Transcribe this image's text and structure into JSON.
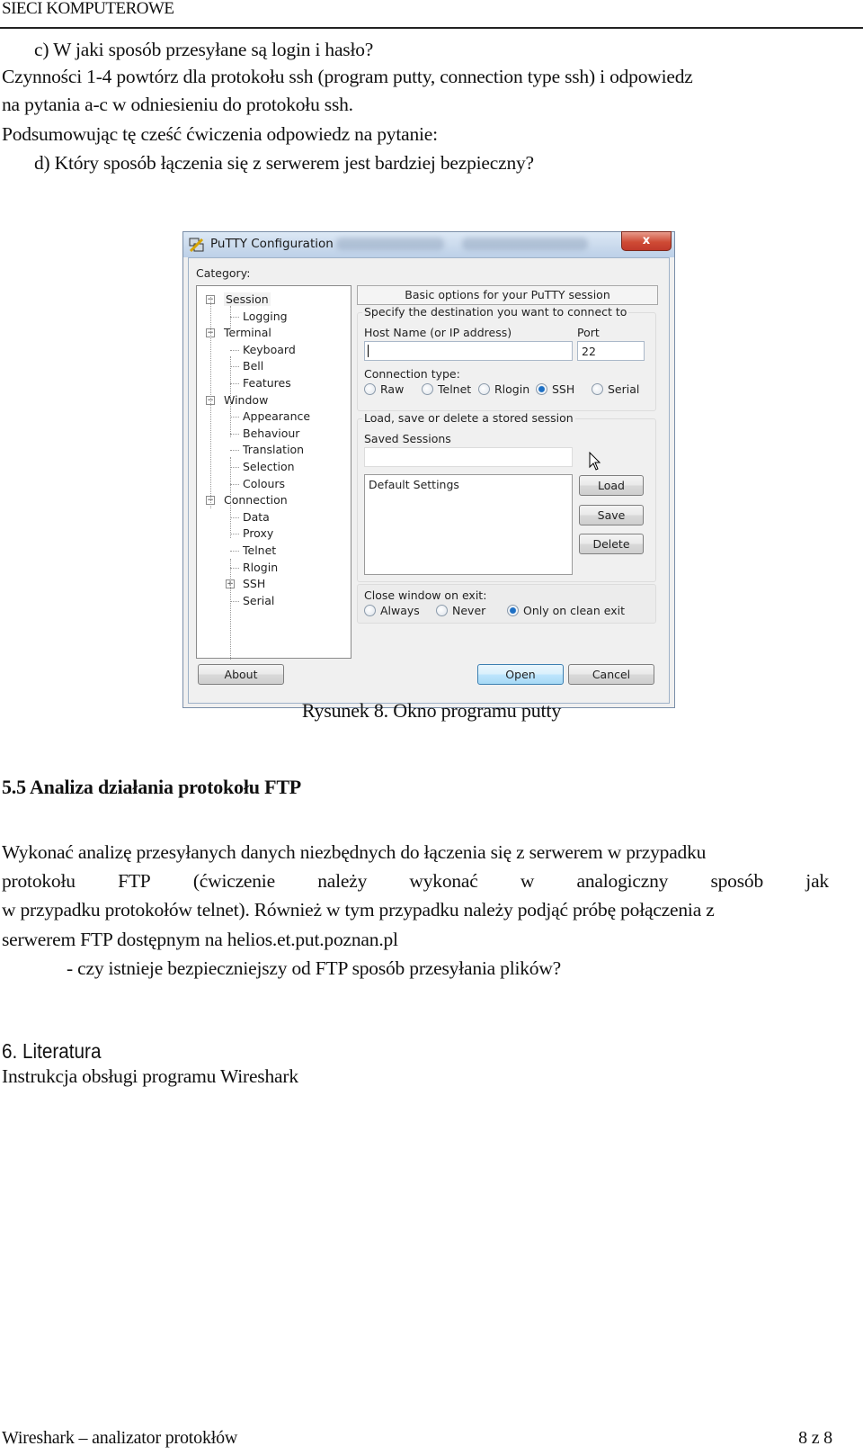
{
  "page_header": {
    "title": "SIECI KOMPUTEROWE"
  },
  "intro": {
    "question_c": "c)  W jaki sposób przesyłane są login i hasło?",
    "line1": "Czynności 1-4 powtórz dla protokołu ssh (program putty, connection type ssh) i odpowiedz",
    "line2": "na pytania a-c w odniesieniu do protokołu ssh.",
    "line3": "Podsumowując tę cześć ćwiczenia odpowiedz na pytanie:",
    "question_d": "d)  Który sposób łączenia się z serwerem jest bardziej bezpieczny?"
  },
  "figure": {
    "window_title": "PuTTY Configuration",
    "close_label": "x",
    "category_label": "Category:",
    "tree": [
      {
        "label": "Session",
        "level": 0,
        "expander": "minus",
        "selected": true
      },
      {
        "label": "Logging",
        "level": 1
      },
      {
        "label": "Terminal",
        "level": 0,
        "expander": "minus"
      },
      {
        "label": "Keyboard",
        "level": 1
      },
      {
        "label": "Bell",
        "level": 1
      },
      {
        "label": "Features",
        "level": 1
      },
      {
        "label": "Window",
        "level": 0,
        "expander": "minus"
      },
      {
        "label": "Appearance",
        "level": 1
      },
      {
        "label": "Behaviour",
        "level": 1
      },
      {
        "label": "Translation",
        "level": 1
      },
      {
        "label": "Selection",
        "level": 1
      },
      {
        "label": "Colours",
        "level": 1
      },
      {
        "label": "Connection",
        "level": 0,
        "expander": "minus"
      },
      {
        "label": "Data",
        "level": 1
      },
      {
        "label": "Proxy",
        "level": 1
      },
      {
        "label": "Telnet",
        "level": 1
      },
      {
        "label": "Rlogin",
        "level": 1
      },
      {
        "label": "SSH",
        "level": 1,
        "expander": "plus"
      },
      {
        "label": "Serial",
        "level": 1
      }
    ],
    "options_header": "Basic options for your PuTTY session",
    "destination_group": "Specify the destination you want to connect to",
    "host_label": "Host Name (or IP address)",
    "host_value": "",
    "port_label": "Port",
    "port_value": "22",
    "conn_type_label": "Connection type:",
    "conn_types": [
      {
        "label": "Raw",
        "checked": false
      },
      {
        "label": "Telnet",
        "checked": false
      },
      {
        "label": "Rlogin",
        "checked": false
      },
      {
        "label": "SSH",
        "checked": true
      },
      {
        "label": "Serial",
        "checked": false
      }
    ],
    "sessions_group": "Load, save or delete a stored session",
    "saved_sessions_label": "Saved Sessions",
    "saved_sessions_value": "",
    "sessions_list": [
      "Default Settings"
    ],
    "load_label": "Load",
    "save_label": "Save",
    "delete_label": "Delete",
    "close_exit_label": "Close window on exit:",
    "close_exit_options": [
      {
        "label": "Always",
        "checked": false
      },
      {
        "label": "Never",
        "checked": false
      },
      {
        "label": "Only on clean exit",
        "checked": true
      }
    ],
    "about_label": "About",
    "open_label": "Open",
    "cancel_label": "Cancel",
    "caption": "Rysunek 8. Okno programu putty"
  },
  "section_ftp": {
    "heading": "5.5 Analiza działania protokołu FTP",
    "p1": "Wykonać analizę przesyłanych danych niezbędnych do łączenia się z serwerem w przypadku",
    "p2_words": [
      "protokołu",
      "FTP",
      "(ćwiczenie",
      "należy",
      "wykonać",
      "w",
      "analogiczny",
      "sposób",
      "jak"
    ],
    "p3": "w przypadku protokołów telnet). Również w tym przypadku należy podjąć próbę połączenia z",
    "p4": "serwerem FTP dostępnym na helios.et.put.poznan.pl",
    "question": "- czy istnieje bezpieczniejszy od FTP sposób przesyłania plików?"
  },
  "section_lit": {
    "heading": "6. Literatura",
    "item": "Instrukcja obsługi programu Wireshark"
  },
  "page_footer": {
    "left": "Wireshark – analizator protokłów",
    "right": "8 z 8"
  }
}
